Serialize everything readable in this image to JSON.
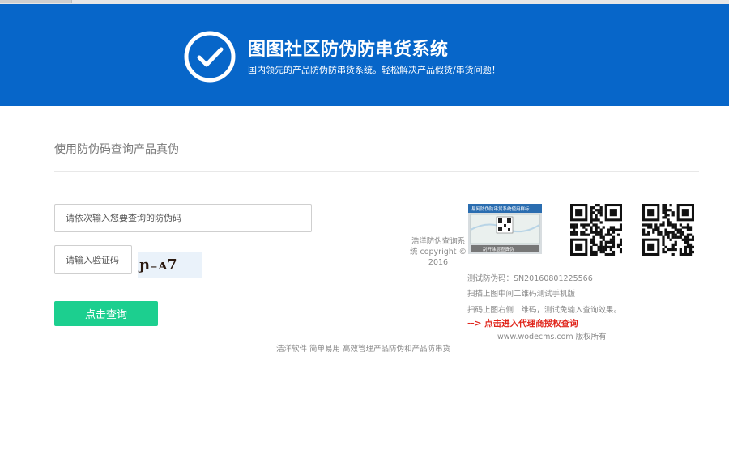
{
  "banner": {
    "title": "图图社区防伪防串货系统",
    "subtitle": "国内领先的产品防伪防串货系统。轻松解决产品假货/串货问题！"
  },
  "section": {
    "title": "使用防伪码查询产品真伪"
  },
  "form": {
    "code_placeholder": "请依次输入您要查询的防伪码",
    "captcha_placeholder": "请输入验证码",
    "captcha_text": "ɲ₋ᴀ7",
    "submit_label": "点击查询"
  },
  "copyright": "浩洋防伪查询系统 copyright © 2016",
  "label_image": {
    "header": "易网防伪防串货系统使用样标",
    "footer": "刮开涂层查真伪"
  },
  "info": {
    "test_code": "测试防伪码：SN20160801225566",
    "line1": "扫描上图中间二维码测试手机版",
    "line2": "扫码上图右侧二维码，测试免输入查询效果。",
    "agent_link": "--> 点击进入代理商授权查询",
    "site": "www.wodecms.com 版权所有"
  },
  "footer": "浩洋软件 简单易用 高效管理产品防伪和产品防串货",
  "colors": {
    "banner": "#0766c9",
    "button": "#1ccf8f",
    "link": "#e0261c"
  }
}
